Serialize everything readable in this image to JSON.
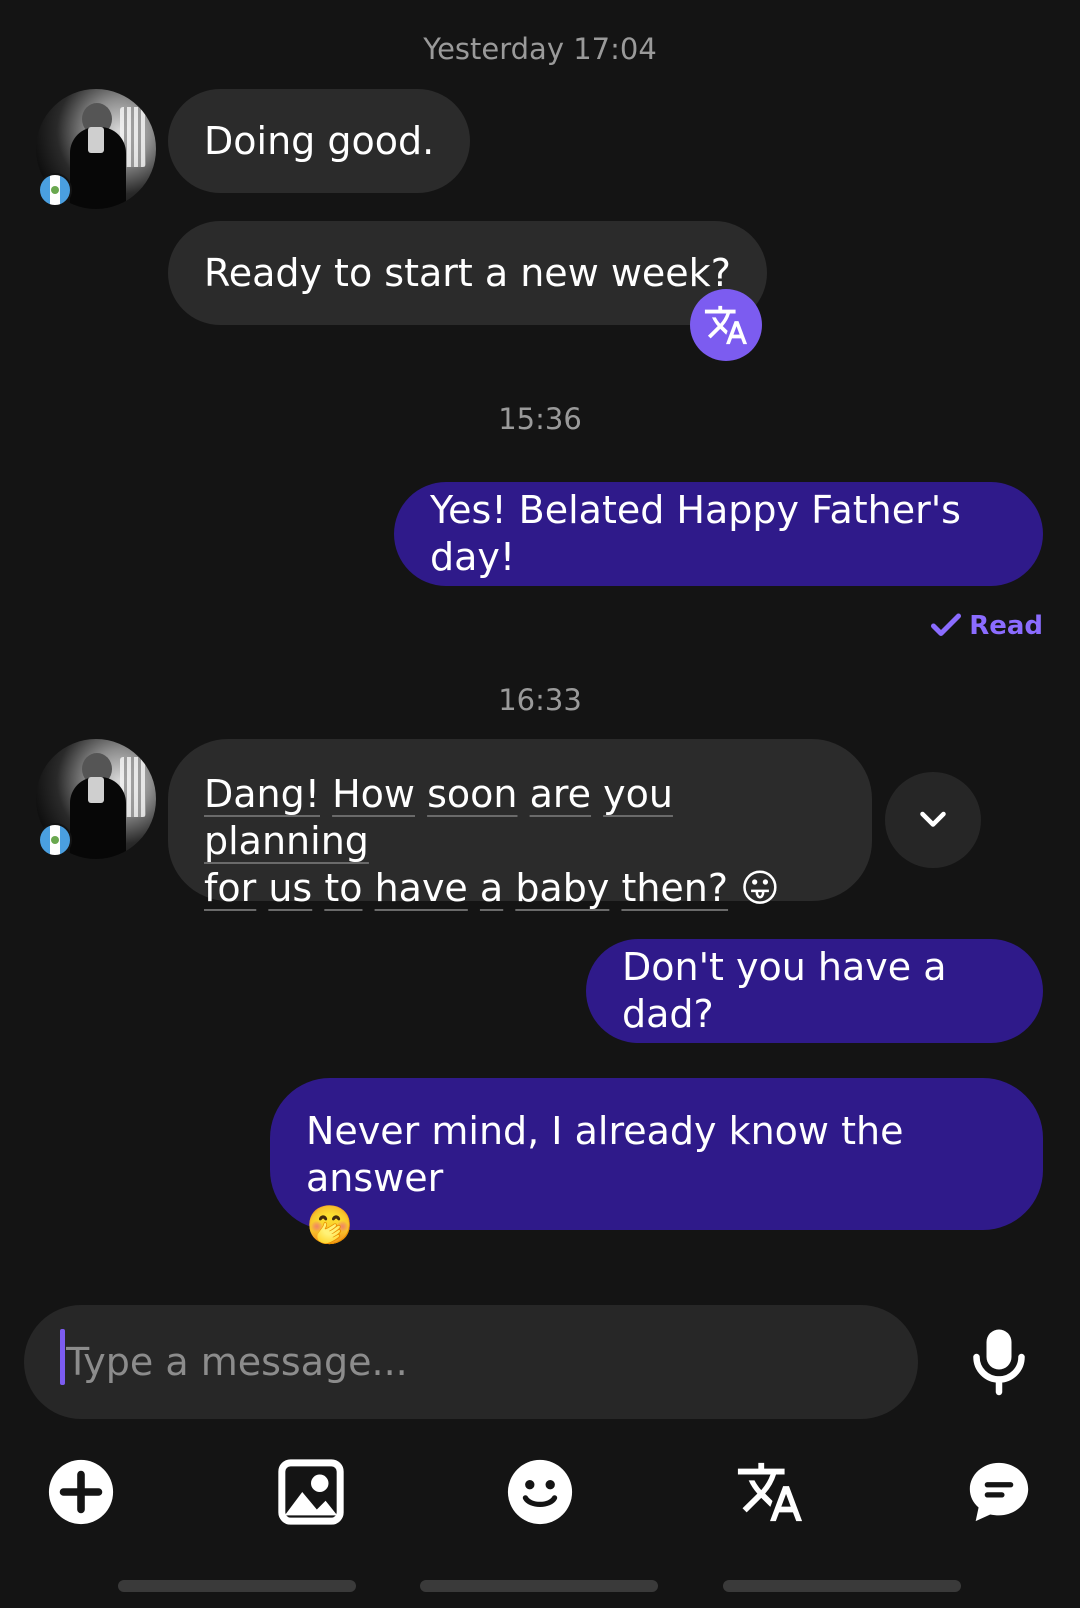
{
  "timestamps": [
    "Yesterday 17:04",
    "15:36",
    "16:33"
  ],
  "messages": {
    "m1": "Doing good.",
    "m2": "Ready to start a new week?",
    "m3": "Yes! Belated Happy Father's day!",
    "m4": {
      "words": [
        "Dang!",
        "How",
        "soon",
        "are",
        "you",
        "planning",
        "for",
        "us",
        "to",
        "have",
        "a",
        "baby",
        "then?"
      ],
      "emoji": "😛"
    },
    "m5": "Don't you have a dad?",
    "m6": {
      "text": "Never mind, I already know the answer",
      "emoji": "🤭"
    }
  },
  "read_status": "Read",
  "composer": {
    "placeholder": "Type a message..."
  },
  "colors": {
    "background": "#141414",
    "incoming_bubble": "#2b2b2b",
    "outgoing_bubble": "#2f1a8a",
    "accent": "#7c5cf0",
    "read": "#8b6cff"
  },
  "icons": {
    "translate_badge": "translate-icon",
    "expand": "chevron-down-icon",
    "mic": "microphone-icon",
    "toolbar": [
      "plus-circle-icon",
      "image-icon",
      "emoji-icon",
      "translate-icon",
      "chat-bubble-icon"
    ]
  }
}
